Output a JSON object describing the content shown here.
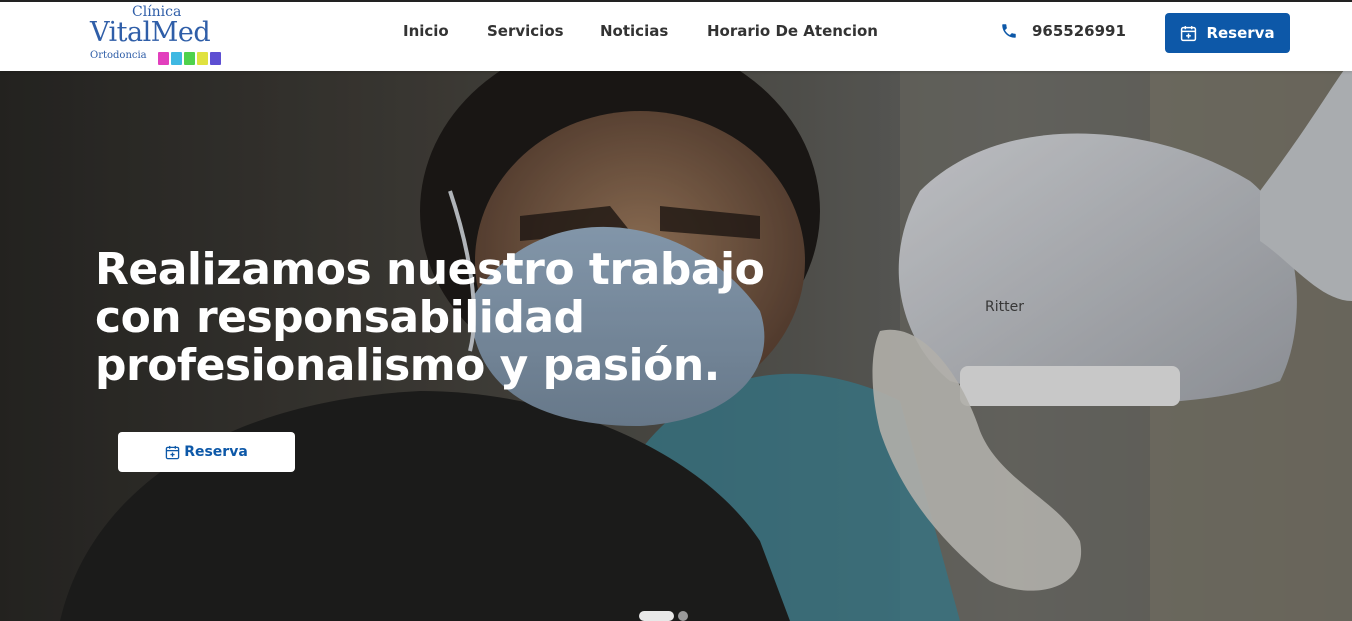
{
  "logo": {
    "top_text": "Clínica",
    "main_text": "VitalMed",
    "sub_text": "Ortodoncia",
    "bar_colors": [
      "#e23fbd",
      "#3fb8e2",
      "#4fd24c",
      "#e0e23f",
      "#5d4fd2"
    ]
  },
  "nav": {
    "items": [
      {
        "label": "Inicio"
      },
      {
        "label": "Servicios"
      },
      {
        "label": "Noticias"
      },
      {
        "label": "Horario De Atencion"
      }
    ]
  },
  "contact": {
    "phone": "965526991",
    "phone_icon": "phone-icon"
  },
  "header_cta": {
    "label": "Reserva",
    "icon": "calendar-plus-icon"
  },
  "hero": {
    "title_lines": [
      "Realizamos nuestro trabajo",
      "con responsabilidad",
      "profesionalismo y pasión."
    ],
    "cta_label": "Reserva",
    "cta_icon": "calendar-plus-icon",
    "slides": {
      "count": 2,
      "active": 1
    }
  },
  "colors": {
    "brand_blue": "#0d58a8",
    "logo_blue": "#2f5ea8",
    "nav_text": "#333333"
  }
}
